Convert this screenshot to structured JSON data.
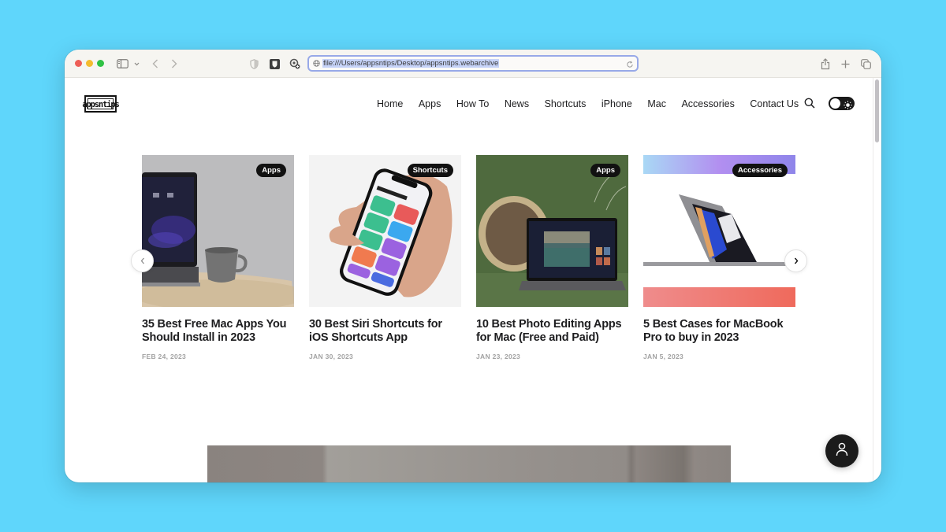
{
  "browser": {
    "url": "file:///Users/appsntips/Desktop/appsntips.webarchive",
    "toolbar_icons": [
      "sidebar-icon",
      "chevron-down-icon",
      "back-icon",
      "forward-icon",
      "privacy-shield-icon",
      "bitwarden-icon",
      "extension-icon",
      "globe-icon",
      "reload-icon",
      "share-icon",
      "new-tab-icon",
      "tab-overview-icon"
    ]
  },
  "site": {
    "logo_text": "appsntips",
    "nav": [
      {
        "label": "Home"
      },
      {
        "label": "Apps"
      },
      {
        "label": "How To"
      },
      {
        "label": "News"
      },
      {
        "label": "Shortcuts"
      },
      {
        "label": "iPhone"
      },
      {
        "label": "Mac"
      },
      {
        "label": "Accessories"
      },
      {
        "label": "Contact Us"
      }
    ]
  },
  "carousel": {
    "cards": [
      {
        "category": "Apps",
        "title": "35 Best Free Mac Apps You Should Install in 2023",
        "date": "FEB 24, 2023",
        "image": "laptop-and-mug"
      },
      {
        "category": "Shortcuts",
        "title": "30 Best Siri Shortcuts for iOS Shortcuts App",
        "date": "JAN 30, 2023",
        "image": "hand-holding-iphone-shortcuts"
      },
      {
        "category": "Apps",
        "title": "10 Best Photo Editing Apps for Mac (Free and Paid)",
        "date": "JAN 23, 2023",
        "image": "macbook-photo-editor-green"
      },
      {
        "category": "Accessories",
        "title": "5 Best Cases for MacBook Pro to buy in 2023",
        "date": "JAN 5, 2023",
        "image": "macbook-pro-gradient"
      }
    ]
  },
  "colors": {
    "desktop_bg": "#5fd6fb",
    "badge_bg": "#111111",
    "url_highlight": "#c6d3f8",
    "url_focus_ring": "#98a9e8"
  }
}
